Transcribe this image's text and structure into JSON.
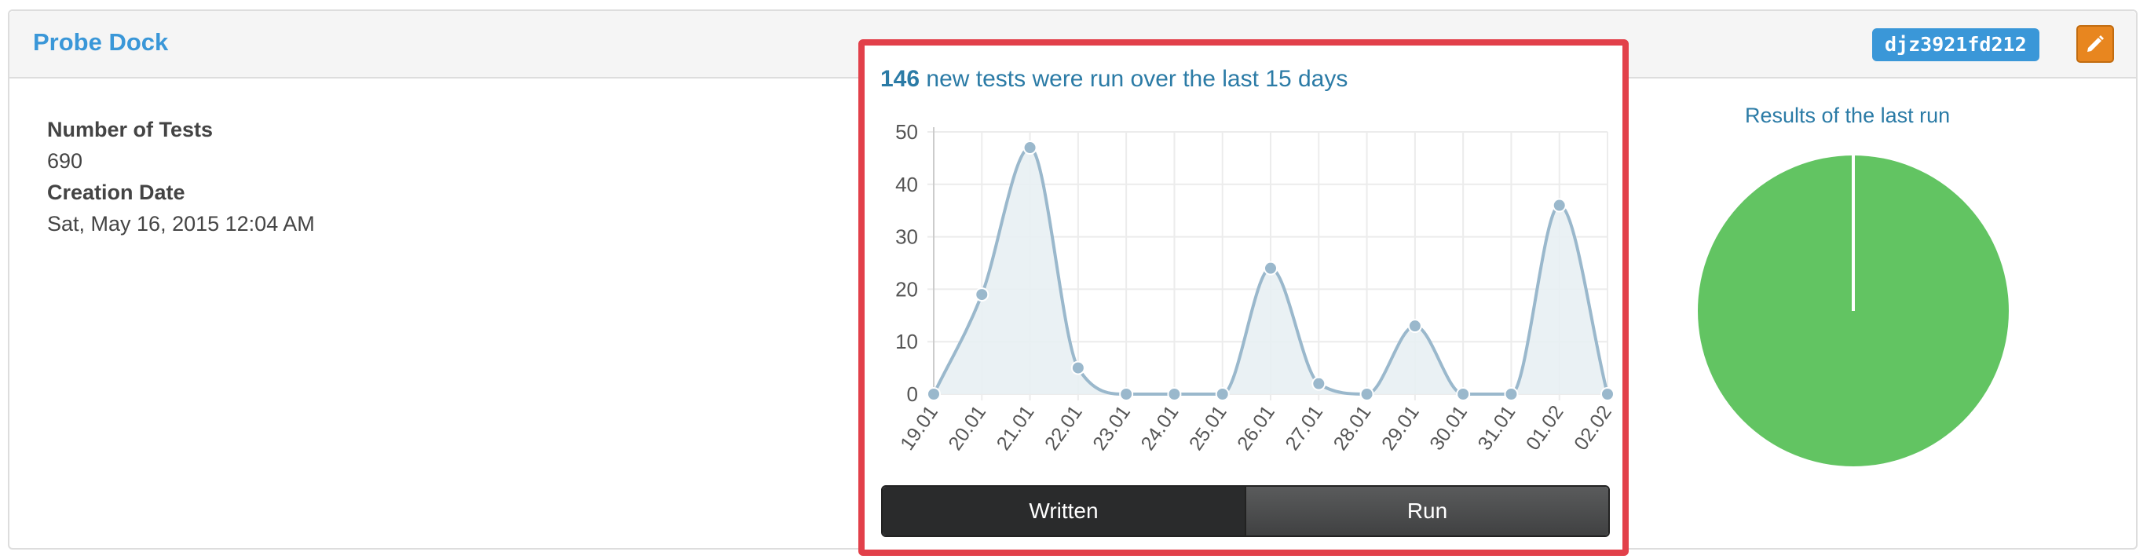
{
  "header": {
    "project_name": "Probe Dock",
    "api_id": "djz3921fd212",
    "edit_icon": "pencil-icon"
  },
  "info": {
    "tests_label": "Number of Tests",
    "tests_value": "690",
    "date_label": "Creation Date",
    "date_value": "Sat, May 16, 2015 12:04 AM"
  },
  "trend": {
    "count": "146",
    "title_rest": "new tests were run over the last 15 days",
    "toggle_written": "Written",
    "toggle_run": "Run"
  },
  "pie": {
    "title": "Results of the last run"
  },
  "colors": {
    "accent": "#3a97d8",
    "highlight": "#e2404a",
    "line": "#9ab8cc",
    "fill": "#e8eff3",
    "passed": "#62c462"
  },
  "chart_data": [
    {
      "type": "line",
      "title": "146 new tests were run over the last 15 days",
      "categories": [
        "19.01",
        "20.01",
        "21.01",
        "22.01",
        "23.01",
        "24.01",
        "25.01",
        "26.01",
        "27.01",
        "28.01",
        "29.01",
        "30.01",
        "31.01",
        "01.02",
        "02.02"
      ],
      "series": [
        {
          "values": [
            0,
            19,
            47,
            5,
            0,
            0,
            0,
            24,
            2,
            0,
            13,
            0,
            0,
            36,
            0
          ]
        }
      ],
      "yticks": [
        "0",
        "10",
        "20",
        "30",
        "40",
        "50"
      ],
      "ylim": [
        0,
        50
      ],
      "grid": true
    },
    {
      "type": "pie",
      "title": "Results of the last run",
      "values": [
        1
      ],
      "colors": [
        "#62c462"
      ]
    }
  ]
}
